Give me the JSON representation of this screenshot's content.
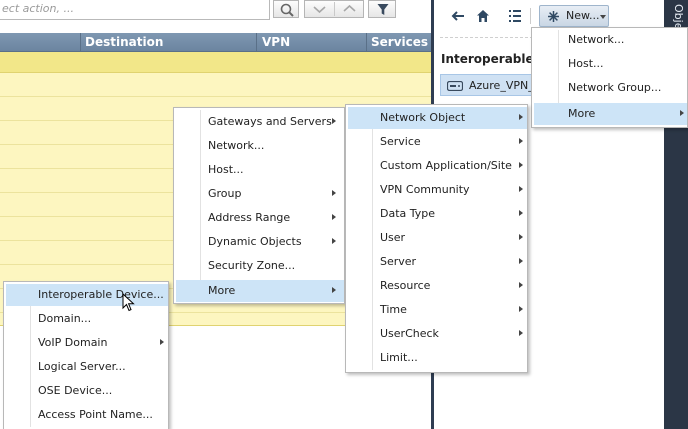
{
  "search": {
    "placeholder": "ect action, ..."
  },
  "columns": [
    "Destination",
    "VPN",
    "Services"
  ],
  "right_pane": {
    "new_button": "New...",
    "section_title": "Interoperable De",
    "selected_item": "Azure_VPN_G"
  },
  "side_tab": "Objects",
  "new_menu": [
    {
      "label": "Network...",
      "submenu": false
    },
    {
      "label": "Host...",
      "submenu": false
    },
    {
      "label": "Network Group...",
      "submenu": false
    },
    {
      "label": "More",
      "submenu": true,
      "highlighted": true
    }
  ],
  "more_menu_main": [
    {
      "label": "Gateways and Servers",
      "submenu": true
    },
    {
      "label": "Network...",
      "submenu": false
    },
    {
      "label": "Host...",
      "submenu": false
    },
    {
      "label": "Group",
      "submenu": true
    },
    {
      "label": "Address Range",
      "submenu": true
    },
    {
      "label": "Dynamic Objects",
      "submenu": true
    },
    {
      "label": "Security Zone...",
      "submenu": false
    },
    {
      "label": "More",
      "submenu": true,
      "highlighted": true
    }
  ],
  "network_object_menu": [
    {
      "label": "Network Object",
      "submenu": true,
      "highlighted": true
    },
    {
      "label": "Service",
      "submenu": true
    },
    {
      "label": "Custom Application/Site",
      "submenu": true
    },
    {
      "label": "VPN Community",
      "submenu": true
    },
    {
      "label": "Data Type",
      "submenu": true
    },
    {
      "label": "User",
      "submenu": true
    },
    {
      "label": "Server",
      "submenu": true
    },
    {
      "label": "Resource",
      "submenu": true
    },
    {
      "label": "Time",
      "submenu": true
    },
    {
      "label": "UserCheck",
      "submenu": true
    },
    {
      "label": "Limit...",
      "submenu": false
    }
  ],
  "more_submenu": [
    {
      "label": "Interoperable Device...",
      "submenu": false,
      "highlighted": true
    },
    {
      "label": "Domain...",
      "submenu": false
    },
    {
      "label": "VoIP Domain",
      "submenu": true
    },
    {
      "label": "Logical Server...",
      "submenu": false
    },
    {
      "label": "OSE Device...",
      "submenu": false
    },
    {
      "label": "Access Point Name...",
      "submenu": false
    }
  ],
  "colors": {
    "highlight": "#cde4f7",
    "header_blue": "#7390ad",
    "rule_yellow": "#fdf6c0",
    "dark_sidebar": "#2b3646"
  },
  "icons": [
    "search-icon",
    "chevron-down-icon",
    "chevron-up-icon",
    "filter-icon",
    "hamburger-menu-icon",
    "back-arrow-icon",
    "home-icon",
    "list-icon",
    "star-icon",
    "device-icon",
    "mouse-cursor-icon"
  ]
}
